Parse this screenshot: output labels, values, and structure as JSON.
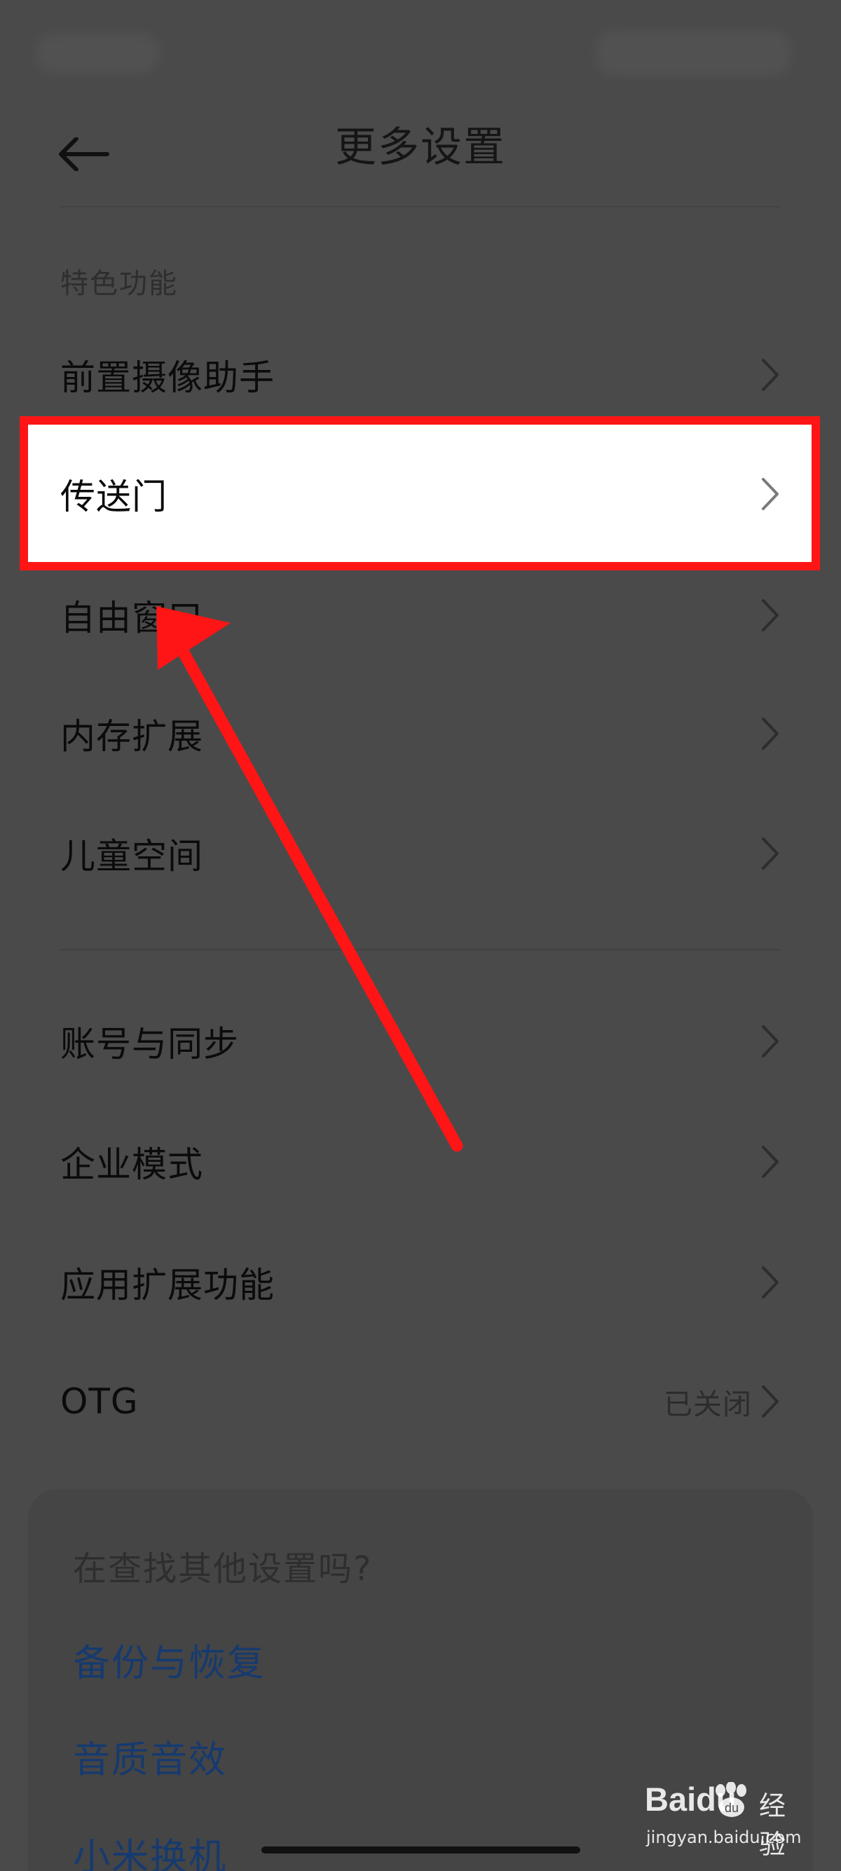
{
  "header": {
    "title": "更多设置"
  },
  "section": {
    "title": "特色功能"
  },
  "items": [
    {
      "label": "前置摄像助手",
      "status": ""
    },
    {
      "label": "传送门",
      "status": ""
    },
    {
      "label": "自由窗口",
      "status": ""
    },
    {
      "label": "内存扩展",
      "status": ""
    },
    {
      "label": "儿童空间",
      "status": ""
    },
    {
      "label": "账号与同步",
      "status": ""
    },
    {
      "label": "企业模式",
      "status": ""
    },
    {
      "label": "应用扩展功能",
      "status": ""
    },
    {
      "label": "OTG",
      "status": "已关闭"
    }
  ],
  "card": {
    "title": "在查找其他设置吗?",
    "links": [
      "备份与恢复",
      "音质音效",
      "小米换机"
    ]
  },
  "watermark": {
    "brand": "Baidu",
    "brand2": "经验",
    "url": "jingyan.baidu.com"
  },
  "colors": {
    "highlight": "#ff1515",
    "link": "#163a6f",
    "dim_background": "#4a4a4a"
  }
}
